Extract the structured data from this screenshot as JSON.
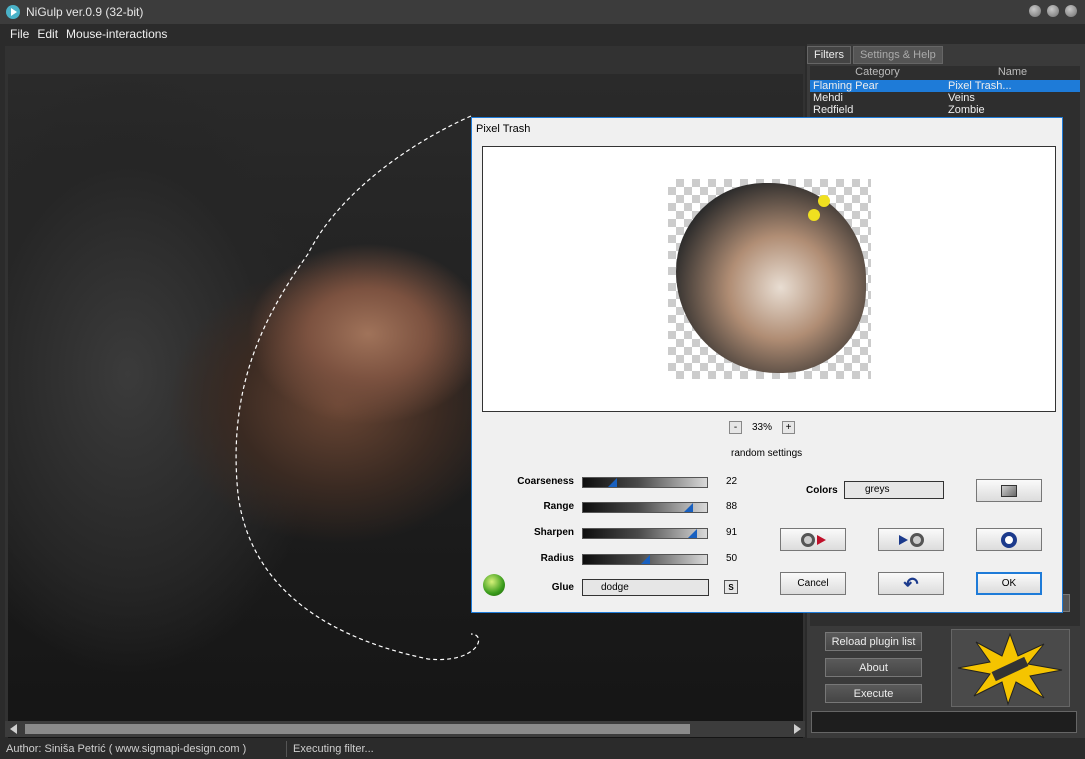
{
  "app": {
    "title": "NiGulp ver.0.9 (32-bit)"
  },
  "menu": [
    "File",
    "Edit",
    "Mouse-interactions"
  ],
  "status": {
    "author": "Author:  Siniša Petrić ( www.sigmapi-design.com )",
    "message": "Executing filter..."
  },
  "panel": {
    "tabs": [
      "Filters",
      "Settings & Help"
    ],
    "columns": [
      "Category",
      "Name"
    ],
    "rows": [
      {
        "category": "Flaming Pear",
        "name": "Pixel Trash..."
      },
      {
        "category": "Mehdi",
        "name": "Veins"
      },
      {
        "category": "Redfield",
        "name": "Zombie"
      }
    ],
    "buttons": {
      "reload": "Reload plugin list",
      "about": "About",
      "execute": "Execute"
    }
  },
  "dialog": {
    "title": "Pixel Trash",
    "zoom": {
      "minus": "-",
      "value": "33%",
      "plus": "+"
    },
    "random_label": "random settings",
    "sliders": [
      {
        "label": "Coarseness",
        "value": 22
      },
      {
        "label": "Range",
        "value": 88
      },
      {
        "label": "Sharpen",
        "value": 91
      },
      {
        "label": "Radius",
        "value": 50
      }
    ],
    "glue": {
      "label": "Glue",
      "value": "dodge",
      "button": "S"
    },
    "colors": {
      "label": "Colors",
      "value": "greys"
    },
    "buttons": {
      "cancel": "Cancel",
      "ok": "OK"
    }
  },
  "colors": {
    "accent": "#1e7bd8",
    "dark_bg": "#2b2b2b"
  }
}
